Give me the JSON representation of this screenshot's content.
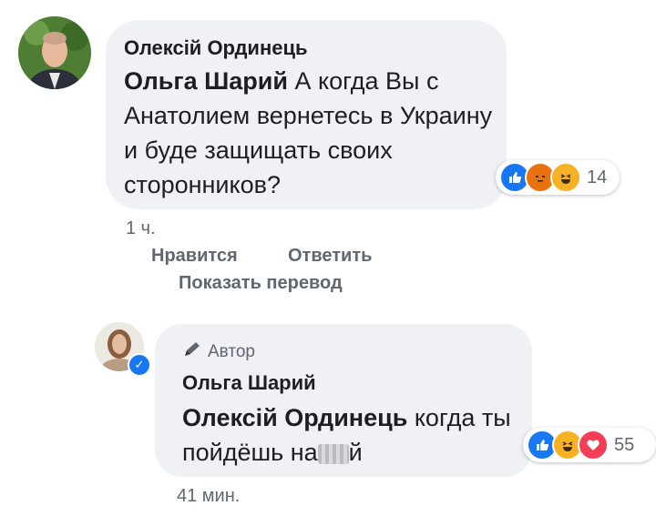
{
  "comment1": {
    "author": "Олексій Ординець",
    "mention": "Ольга Шарий",
    "text": " А когда Вы с Анатолием вернетесь в Украину и буде защищать своих сторонников?",
    "reaction_count": "14",
    "time": "1 ч.",
    "like_label": "Нравится",
    "reply_label": "Ответить",
    "translate_label": "Показать перевод"
  },
  "comment2": {
    "badge": "Автор",
    "author": "Ольга Шарий",
    "mention": "Олексій Ординець",
    "text_before": " когда ты пойдёшь на",
    "text_after": "й",
    "reaction_count": "55",
    "time": "41 мин."
  },
  "colors": {
    "bubble": "#eff1f4",
    "meta": "#606770",
    "like_blue": "#1877f2"
  }
}
